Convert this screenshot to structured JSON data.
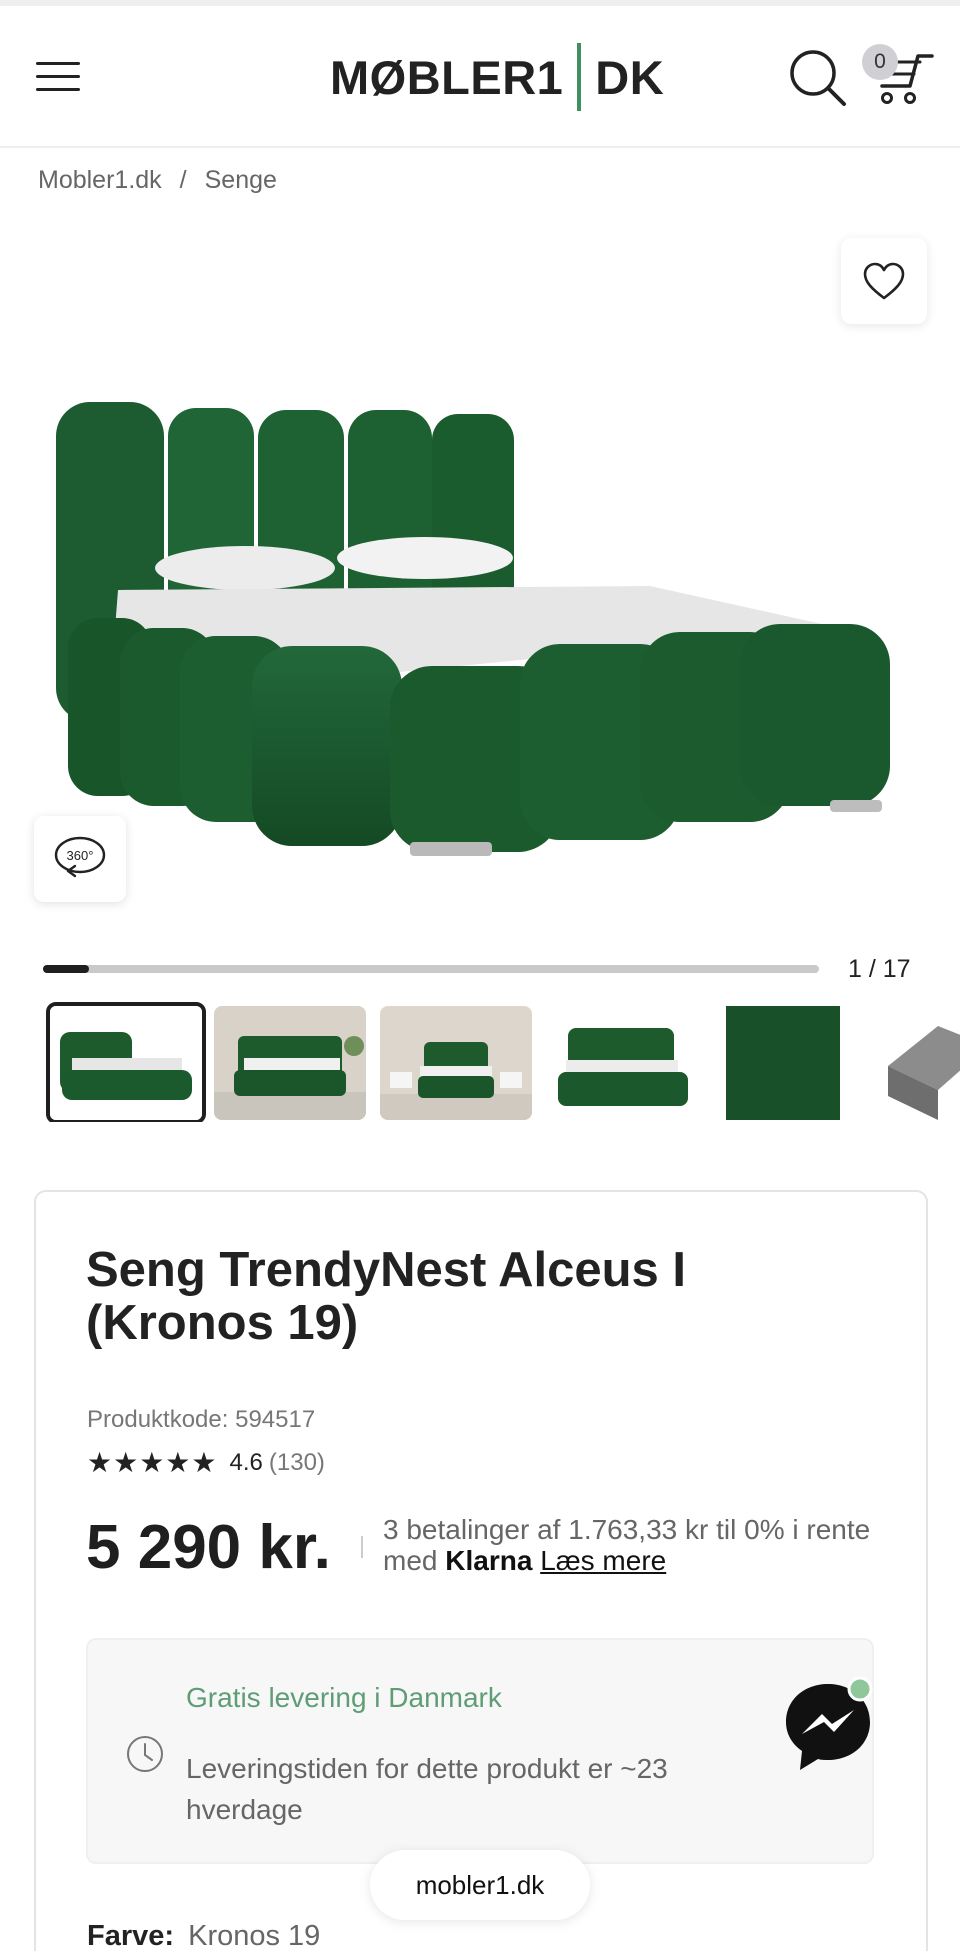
{
  "header": {
    "logo_left": "MØBLER1",
    "logo_right": "DK",
    "cart_count": "0"
  },
  "breadcrumb": {
    "home": "Mobler1.dk",
    "separator": "/",
    "category": "Senge"
  },
  "gallery": {
    "current": "1 / 17",
    "progress_fraction": 0.0588,
    "view360_label": "360°",
    "product_color": "#1d5a2c"
  },
  "product": {
    "title": "Seng TrendyNest Alceus I (Kronos 19)",
    "code": "Produktkode: 594517",
    "rating_value": "4.6",
    "rating_count": "(130)",
    "rating_stars": 4.6,
    "price": "5 290 kr.",
    "installment_text": "3 betalinger af 1.763,33 kr til 0% i rente med",
    "klarna": "Klarna",
    "read_more": "Læs mere"
  },
  "delivery": {
    "title": "Gratis levering i Danmark",
    "text": "Leveringstiden for dette produkt er ~23 hverdage",
    "accent_color": "#5e9d76"
  },
  "footer_pill": "mobler1.dk",
  "color_option": {
    "label": "Farve:",
    "value": "Kronos 19"
  }
}
